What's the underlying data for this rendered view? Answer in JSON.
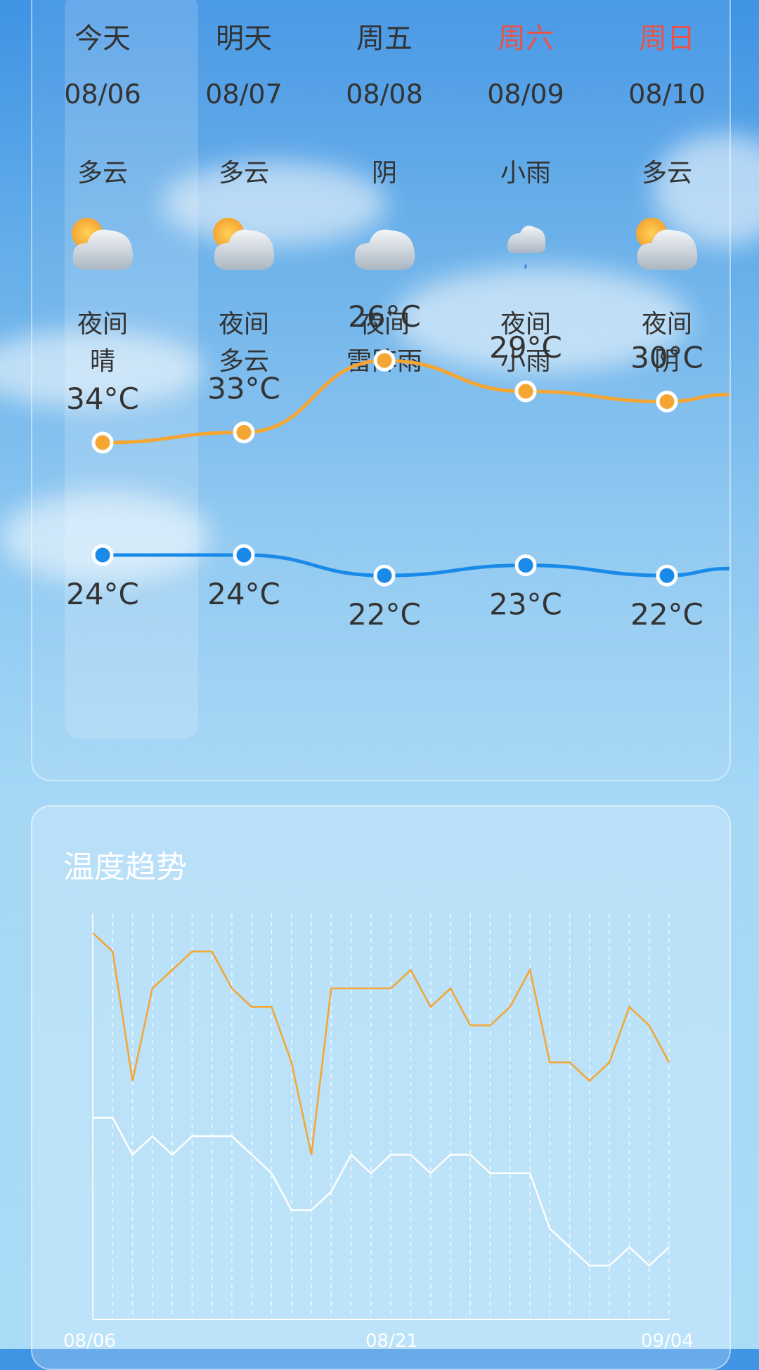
{
  "forecast": {
    "days": [
      {
        "day": "今天",
        "date": "08/06",
        "condition": "多云",
        "icon": "partly-cloudy-icon",
        "night_label": "夜间",
        "night_condition": "晴",
        "high": 34,
        "high_label": "34°C",
        "low": 24,
        "low_label": "24°C",
        "weekend": false
      },
      {
        "day": "明天",
        "date": "08/07",
        "condition": "多云",
        "icon": "partly-cloudy-icon",
        "night_label": "夜间",
        "night_condition": "多云",
        "high": 33,
        "high_label": "33°C",
        "low": 24,
        "low_label": "24°C",
        "weekend": false
      },
      {
        "day": "周五",
        "date": "08/08",
        "condition": "阴",
        "icon": "overcast-icon",
        "night_label": "夜间",
        "night_condition": "雷阵雨",
        "high": 26,
        "high_label": "26°C",
        "low": 22,
        "low_label": "22°C",
        "weekend": false
      },
      {
        "day": "周六",
        "date": "08/09",
        "condition": "小雨",
        "icon": "light-rain-icon",
        "night_label": "夜间",
        "night_condition": "小雨",
        "high": 29,
        "high_label": "29°C",
        "low": 23,
        "low_label": "23°C",
        "weekend": true
      },
      {
        "day": "周日",
        "date": "08/10",
        "condition": "多云",
        "icon": "partly-cloudy-icon",
        "night_label": "夜间",
        "night_condition": "阴",
        "high": 30,
        "high_label": "30°C",
        "low": 22,
        "low_label": "22°C",
        "weekend": true
      }
    ],
    "colors": {
      "high": "#f5a531",
      "low": "#1a8ae8",
      "weekend": "#e8534a"
    }
  },
  "trend": {
    "title": "温度趋势",
    "x_labels": [
      "08/06",
      "08/21",
      "09/04"
    ],
    "chart_data": {
      "type": "line",
      "x": [
        "08/06",
        "08/07",
        "08/08",
        "08/09",
        "08/10",
        "08/11",
        "08/12",
        "08/13",
        "08/14",
        "08/15",
        "08/16",
        "08/17",
        "08/18",
        "08/19",
        "08/20",
        "08/21",
        "08/22",
        "08/23",
        "08/24",
        "08/25",
        "08/26",
        "08/27",
        "08/28",
        "08/29",
        "08/30",
        "08/31",
        "09/01",
        "09/02",
        "09/03",
        "09/04"
      ],
      "series": [
        {
          "color": "#f5a531",
          "values": [
            34,
            33,
            26,
            31,
            32,
            33,
            33,
            31,
            30,
            30,
            27,
            22,
            31,
            31,
            31,
            31,
            32,
            30,
            31,
            29,
            29,
            30,
            32,
            27,
            27,
            26,
            27,
            30,
            29,
            27
          ]
        },
        {
          "color": "#ffffff",
          "values": [
            24,
            24,
            22,
            23,
            22,
            23,
            23,
            23,
            22,
            21,
            19,
            19,
            20,
            22,
            21,
            22,
            22,
            21,
            22,
            22,
            21,
            21,
            21,
            18,
            17,
            16,
            16,
            17,
            16,
            17
          ]
        }
      ]
    }
  }
}
